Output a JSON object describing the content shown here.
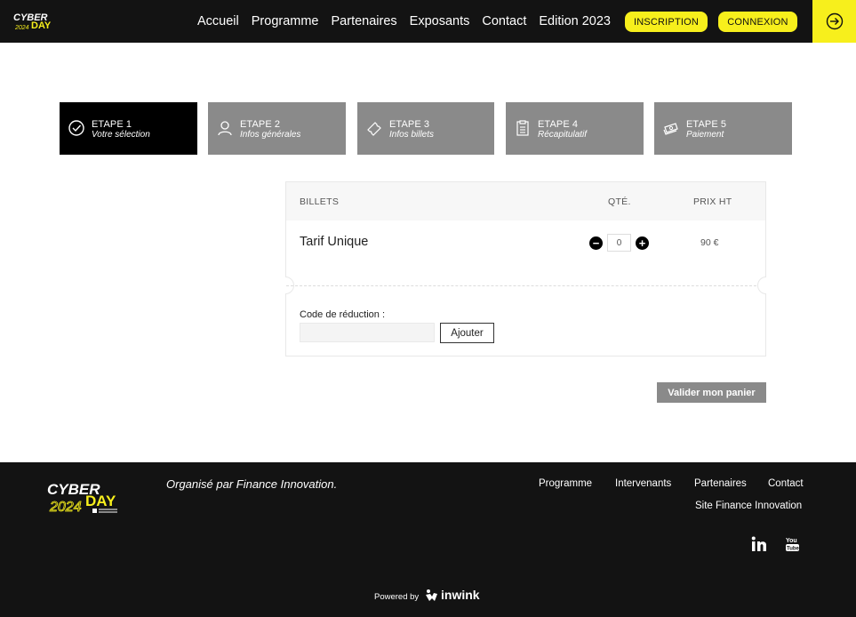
{
  "header": {
    "nav": [
      "Accueil",
      "Programme",
      "Partenaires",
      "Exposants",
      "Contact",
      "Edition 2023"
    ],
    "inscription": "INSCRIPTION",
    "connexion": "CONNEXION",
    "login_icon": "login-arrow-icon",
    "accent_color": "#f7ef1c"
  },
  "steps": [
    {
      "label": "ETAPE 1",
      "sub": "Votre sélection",
      "icon": "check-circle-icon",
      "active": true
    },
    {
      "label": "ETAPE 2",
      "sub": "Infos générales",
      "icon": "user-icon",
      "active": false
    },
    {
      "label": "ETAPE 3",
      "sub": "Infos billets",
      "icon": "ticket-icon",
      "active": false
    },
    {
      "label": "ETAPE 4",
      "sub": "Récapitulatif",
      "icon": "clipboard-icon",
      "active": false
    },
    {
      "label": "ETAPE 5",
      "sub": "Paiement",
      "icon": "cash-icon",
      "active": false
    }
  ],
  "ticket_table": {
    "headers": {
      "billets": "BILLETS",
      "qty": "QTÉ.",
      "price": "PRIX HT"
    },
    "rows": [
      {
        "name": "Tarif Unique",
        "quantity": "0",
        "price": "90 €"
      }
    ]
  },
  "promo": {
    "label": "Code de réduction :",
    "value": "",
    "button": "Ajouter"
  },
  "validate_button": "Valider mon panier",
  "footer": {
    "organized_by": "Organisé par Finance Innovation.",
    "links": [
      "Programme",
      "Intervenants",
      "Partenaires",
      "Contact"
    ],
    "site_link": "Site Finance Innovation",
    "social": [
      "linkedin-icon",
      "youtube-icon"
    ],
    "powered_by": "Powered by",
    "brand": "inwink"
  }
}
